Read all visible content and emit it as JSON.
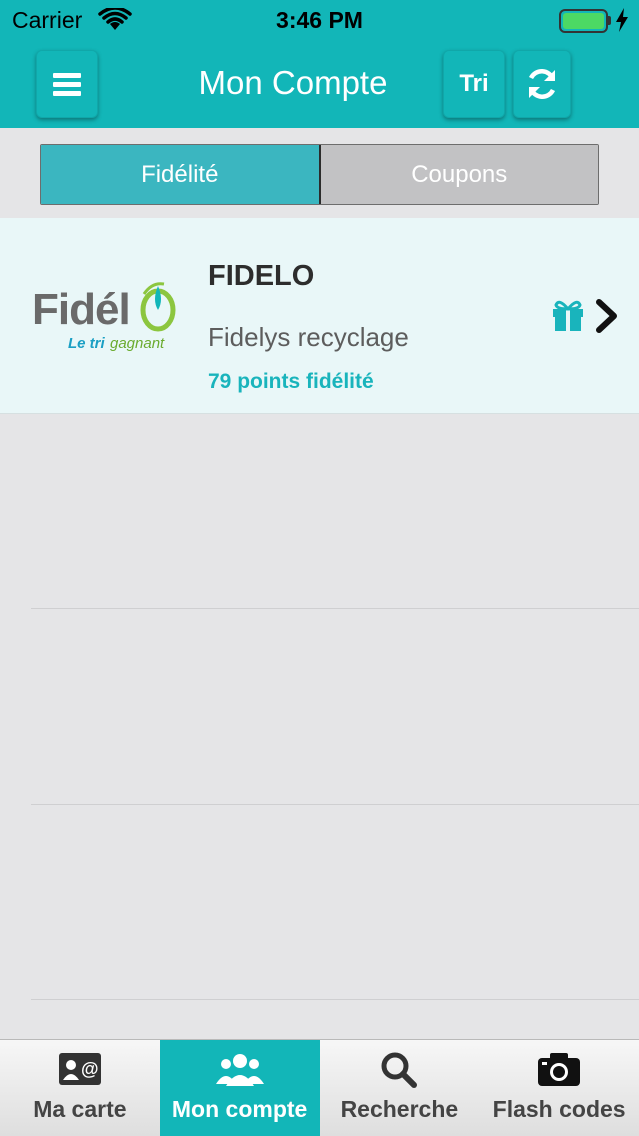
{
  "status_bar": {
    "carrier": "Carrier",
    "time": "3:46 PM"
  },
  "header": {
    "title": "Mon Compte",
    "sort_label": "Tri"
  },
  "segments": [
    {
      "label": "Fidélité",
      "selected": true
    },
    {
      "label": "Coupons",
      "selected": false
    }
  ],
  "accounts": [
    {
      "name": "FIDELO",
      "description": "Fidelys recyclage",
      "points": "79 points fidélité",
      "logo": {
        "brand": "Fidélo",
        "tagline": "Le tri gagnant"
      }
    }
  ],
  "tabs": [
    {
      "label": "Ma carte",
      "icon": "contact-card-icon",
      "selected": false
    },
    {
      "label": "Mon compte",
      "icon": "users-icon",
      "selected": true
    },
    {
      "label": "Recherche",
      "icon": "search-icon",
      "selected": false
    },
    {
      "label": "Flash codes",
      "icon": "camera-icon",
      "selected": false
    }
  ],
  "colors": {
    "brand": "#12b6b8",
    "points": "#19b4bc",
    "battery": "#4cd964"
  }
}
